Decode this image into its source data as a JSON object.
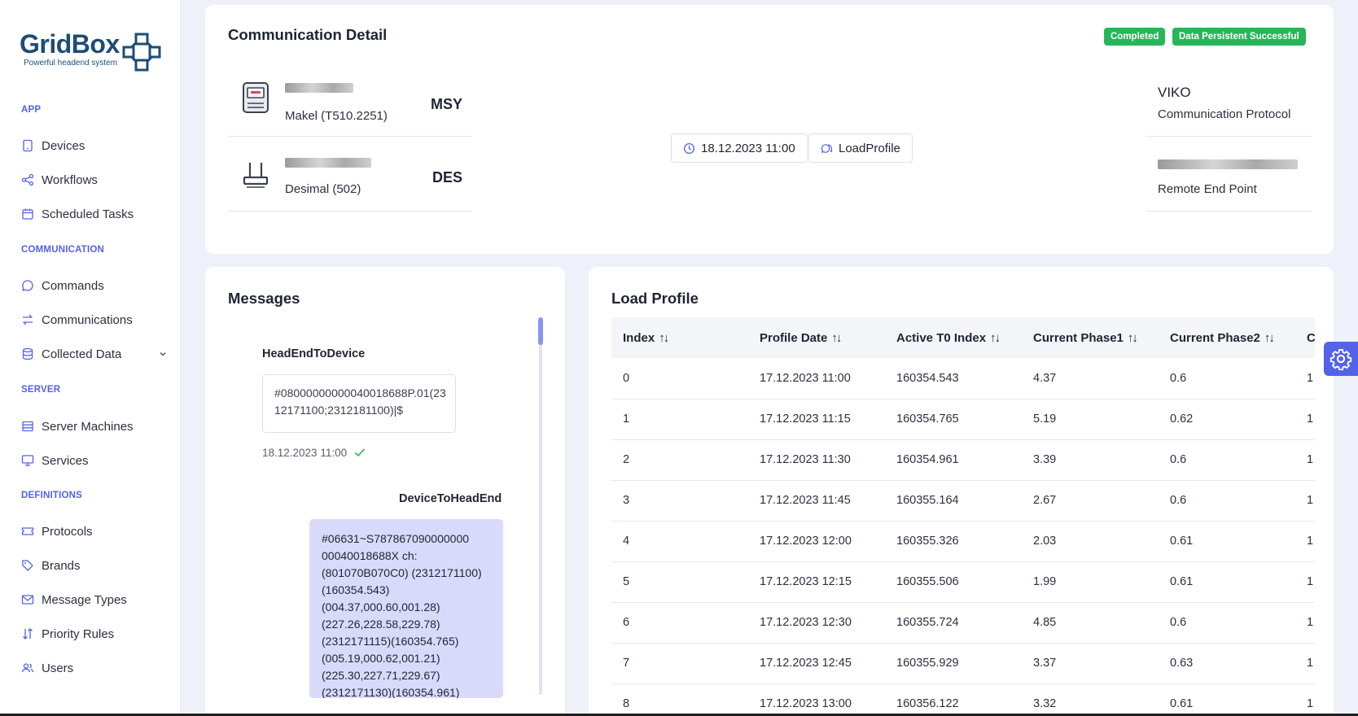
{
  "brand": {
    "name": "GridBox",
    "tagline": "Powerful headend system"
  },
  "sidebar": {
    "sections": [
      {
        "title": "APP",
        "items": [
          {
            "label": "Devices",
            "icon": "device-icon"
          },
          {
            "label": "Workflows",
            "icon": "share-icon"
          },
          {
            "label": "Scheduled Tasks",
            "icon": "calendar-icon"
          }
        ]
      },
      {
        "title": "COMMUNICATION",
        "items": [
          {
            "label": "Commands",
            "icon": "chat-icon"
          },
          {
            "label": "Communications",
            "icon": "transfer-icon"
          },
          {
            "label": "Collected Data",
            "icon": "database-icon",
            "expandable": true
          }
        ]
      },
      {
        "title": "SERVER",
        "items": [
          {
            "label": "Server Machines",
            "icon": "server-icon"
          },
          {
            "label": "Services",
            "icon": "monitor-icon"
          }
        ]
      },
      {
        "title": "DEFINITIONS",
        "items": [
          {
            "label": "Protocols",
            "icon": "ticket-icon"
          },
          {
            "label": "Brands",
            "icon": "tag-icon"
          },
          {
            "label": "Message Types",
            "icon": "mail-icon"
          },
          {
            "label": "Priority Rules",
            "icon": "sort-icon"
          },
          {
            "label": "Users",
            "icon": "users-icon"
          }
        ]
      }
    ]
  },
  "detail": {
    "title": "Communication Detail",
    "badges": [
      "Completed",
      "Data Persistent Successful"
    ],
    "devices": [
      {
        "name": "Makel (T510.2251)",
        "code": "MSY",
        "icon": "meter-icon"
      },
      {
        "name": "Desimal (502)",
        "code": "DES",
        "icon": "router-icon"
      }
    ],
    "timestamp": "18.12.2023 11:00",
    "message_type": "LoadProfile",
    "protocol": {
      "value": "VIKO",
      "label": "Communication Protocol"
    },
    "endpoint": {
      "label": "Remote End Point"
    }
  },
  "messages": {
    "title": "Messages",
    "outgoing": {
      "direction": "HeadEndToDevice",
      "text": "#08000000000040018688P.01(2312171100;2312181100)|$",
      "time": "18.12.2023 11:00"
    },
    "incoming": {
      "direction": "DeviceToHeadEnd",
      "lines": [
        "#06631~S787867090000000",
        "00040018688X ch:",
        "(801070B070C0) (2312171100)",
        "(160354.543)",
        "(004.37,000.60,001.28)",
        "(227.26,228.58,229.78)",
        "(2312171115)(160354.765)",
        "(005.19,000.62,001.21)",
        "(225.30,227.71,229.67)",
        "(2312171130)(160354.961)"
      ]
    }
  },
  "load_profile": {
    "title": "Load Profile",
    "columns": [
      "Index",
      "Profile Date",
      "Active T0 Index",
      "Current Phase1",
      "Current Phase2",
      "C"
    ],
    "rows": [
      [
        "0",
        "17.12.2023 11:00",
        "160354.543",
        "4.37",
        "0.6",
        "1"
      ],
      [
        "1",
        "17.12.2023 11:15",
        "160354.765",
        "5.19",
        "0.62",
        "1"
      ],
      [
        "2",
        "17.12.2023 11:30",
        "160354.961",
        "3.39",
        "0.6",
        "1"
      ],
      [
        "3",
        "17.12.2023 11:45",
        "160355.164",
        "2.67",
        "0.6",
        "1"
      ],
      [
        "4",
        "17.12.2023 12:00",
        "160355.326",
        "2.03",
        "0.61",
        "1"
      ],
      [
        "5",
        "17.12.2023 12:15",
        "160355.506",
        "1.99",
        "0.61",
        "1"
      ],
      [
        "6",
        "17.12.2023 12:30",
        "160355.724",
        "4.85",
        "0.6",
        "1"
      ],
      [
        "7",
        "17.12.2023 12:45",
        "160355.929",
        "3.37",
        "0.63",
        "1"
      ],
      [
        "8",
        "17.12.2023 13:00",
        "160356.122",
        "3.32",
        "0.61",
        "1"
      ]
    ]
  },
  "colors": {
    "accent": "#5562e8",
    "success": "#26b659",
    "brand": "#1d4d78",
    "message_in_bg": "#d9dafb"
  }
}
